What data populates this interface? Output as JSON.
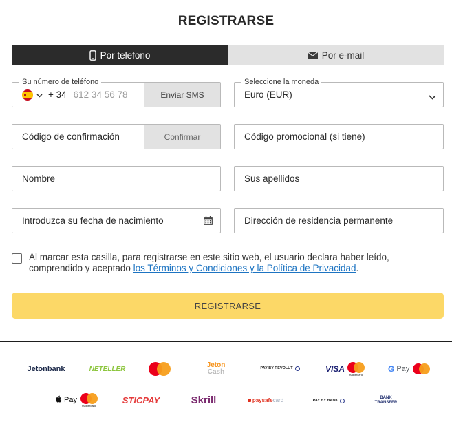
{
  "form": {
    "title": "REGISTRARSE",
    "tabs": [
      {
        "label": "Por telefono",
        "icon": "phone-icon",
        "active": true
      },
      {
        "label": "Por e-mail",
        "icon": "envelope-icon",
        "active": false
      }
    ],
    "phone": {
      "label": "Su número de teléfono",
      "country": "Spain",
      "prefix": "+ 34",
      "placeholder": "612 34 56 78",
      "sms_button": "Enviar SMS"
    },
    "currency": {
      "label": "Seleccione la moneda",
      "value": "Euro (EUR)"
    },
    "confirmation_code": {
      "placeholder": "Código de confirmación",
      "button": "Confirmar"
    },
    "promo_code": {
      "placeholder": "Código promocional (si tiene)"
    },
    "first_name": {
      "placeholder": "Nombre"
    },
    "last_name": {
      "placeholder": "Sus apellidos"
    },
    "birth_date": {
      "placeholder": "Introduzca su fecha de nacimiento"
    },
    "address": {
      "placeholder": "Dirección de residencia permanente"
    },
    "terms": {
      "text": "Al marcar esta casilla, para registrarse en este sitio web, el usuario declara haber leído, comprendido y aceptado",
      "link": "los Términos y Condiciones y la Política de Privacidad",
      "end": "."
    },
    "submit": "REGISTRARSE"
  },
  "payments": {
    "jetonbank": "Jetonbank",
    "neteller": "NETELLER",
    "jeton_cash_1": "Jeton",
    "jeton_cash_2": "Cash",
    "revolut": "PAY BY REVOLUT",
    "visa": "VISA",
    "mastercard_caption": "mastercard",
    "gpay_g": "G",
    "gpay_pay": "Pay",
    "applepay": "Pay",
    "sticpay": "STICPAY",
    "skrill": "Skrill",
    "paysafe_1": "paysafe",
    "paysafe_2": "card",
    "paybybank": "PAY BY BANK",
    "bank_transfer_1": "BANK",
    "bank_transfer_2": "TRANSFER"
  },
  "colors": {
    "active_tab": "#2b2b2b",
    "inactive_tab": "#e2e2e2",
    "submit_button": "#fcd867",
    "link": "#1d74c2"
  }
}
